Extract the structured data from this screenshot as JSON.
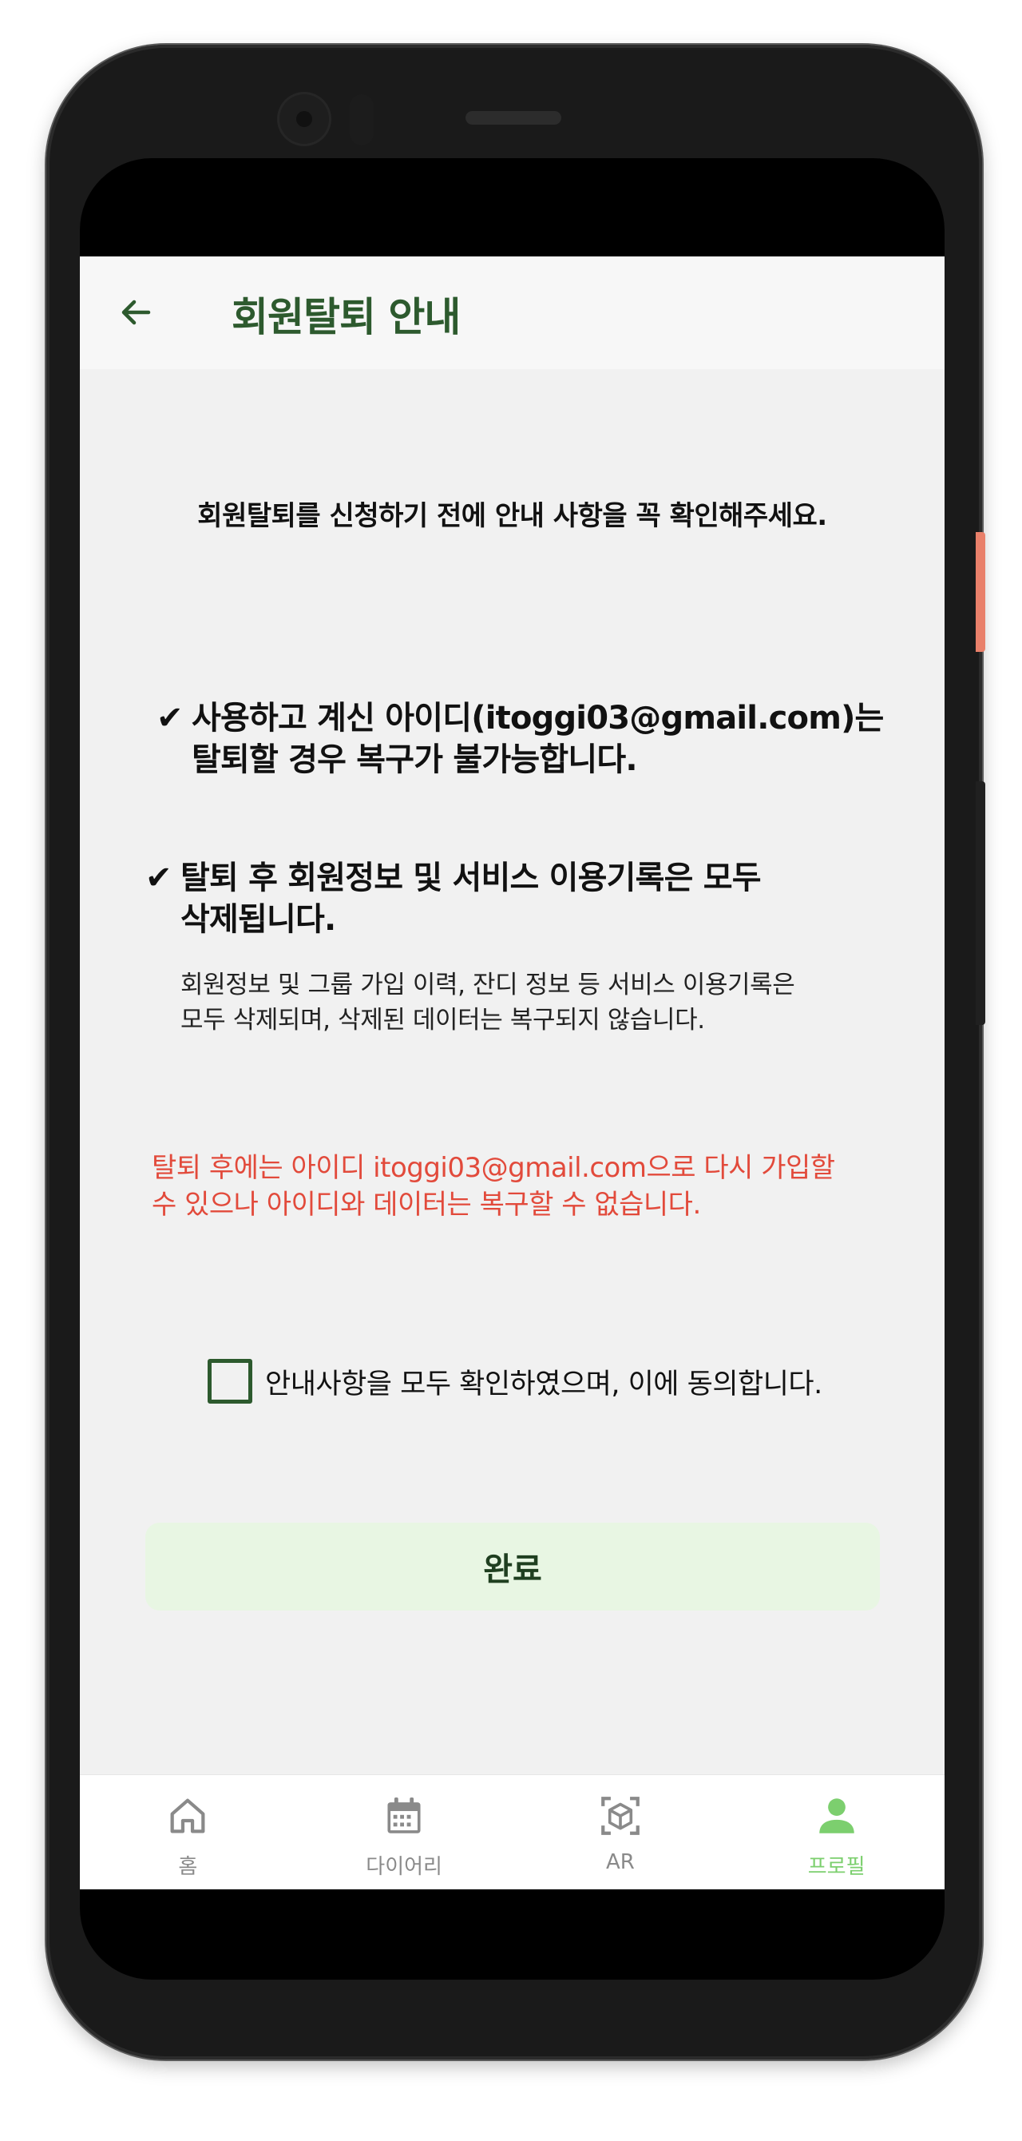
{
  "header": {
    "title": "회원탈퇴 안내"
  },
  "content": {
    "intro": "회원탈퇴를 신청하기 전에 안내 사항을 꼭 확인해주세요.",
    "notice1": {
      "line1": "사용하고 계신 아이디(itoggi03@gmail.com)는",
      "line2": "탈퇴할 경우 복구가 불가능합니다."
    },
    "notice2": {
      "line1": "탈퇴 후 회원정보 및 서비스 이용기록은 모두",
      "line2": "삭제됩니다."
    },
    "notice2_detail": {
      "line1": "회원정보 및 그룹 가입 이력, 잔디 정보 등 서비스 이용기록은",
      "line2": "모두 삭제되며, 삭제된 데이터는 복구되지 않습니다."
    },
    "warning": {
      "line1": "탈퇴 후에는 아이디 itoggi03@gmail.com으로 다시 가입할",
      "line2": "수 있으나 아이디와 데이터는 복구할 수 없습니다."
    },
    "agree_label": "안내사항을 모두 확인하였으며, 이에 동의합니다.",
    "agree_checked": false,
    "done_label": "완료"
  },
  "nav": {
    "items": [
      {
        "label": "홈",
        "icon": "home-icon",
        "active": false
      },
      {
        "label": "다이어리",
        "icon": "calendar-icon",
        "active": false
      },
      {
        "label": "AR",
        "icon": "ar-cube-icon",
        "active": false
      },
      {
        "label": "프로필",
        "icon": "person-icon",
        "active": true
      }
    ]
  },
  "colors": {
    "primary_dark_green": "#2d5a2e",
    "warning_red": "#e24a3b",
    "button_bg": "#e8f6e3",
    "active_nav": "#7ccf6e",
    "inactive_nav": "#8a8a8a"
  }
}
